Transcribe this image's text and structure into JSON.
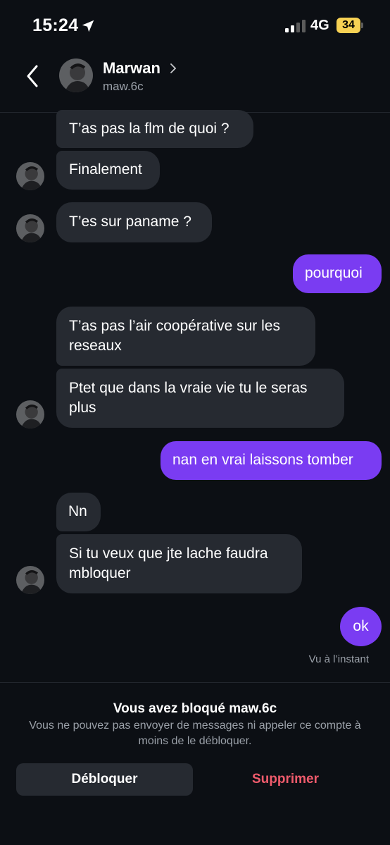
{
  "status_bar": {
    "time": "15:24",
    "network": "4G",
    "battery": "34",
    "battery_color": "#f7d154"
  },
  "header": {
    "name": "Marwan",
    "username": "maw.6c",
    "back_icon": "chevron-left-icon",
    "profile_icon": "chevron-right-icon"
  },
  "messages": [
    {
      "from": "them",
      "text": "T’as pas la flm de quoi ?"
    },
    {
      "from": "them",
      "text": "Finalement"
    },
    {
      "from": "them",
      "text": "T’es sur paname ?"
    },
    {
      "from": "me",
      "text": "pourquoi"
    },
    {
      "from": "them",
      "text": "T’as pas l’air coopérative sur les reseaux"
    },
    {
      "from": "them",
      "text": "Ptet que dans la vraie vie tu le seras plus"
    },
    {
      "from": "me",
      "text": "nan en vrai laissons tomber"
    },
    {
      "from": "them",
      "text": "Nn"
    },
    {
      "from": "them",
      "text": "Si tu veux que jte lache faudra mbloquer"
    },
    {
      "from": "me",
      "text": "ok"
    }
  ],
  "seen_status": "Vu à l’instant",
  "blocked": {
    "title": "Vous avez bloqué maw.6c",
    "description": "Vous ne pouvez pas envoyer de messages ni appeler ce compte à moins de le débloquer.",
    "unblock_label": "Débloquer",
    "delete_label": "Supprimer"
  },
  "colors": {
    "background": "#0c0f14",
    "incoming_bubble": "#262a31",
    "outgoing_bubble": "#7a3cf2",
    "delete_text": "#ef5b6c"
  }
}
